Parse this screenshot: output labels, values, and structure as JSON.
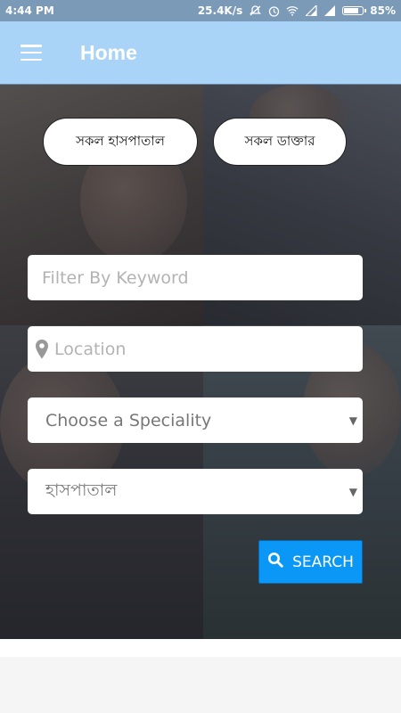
{
  "status_bar": {
    "time": "4:44 PM",
    "net_speed": "25.4K/s",
    "battery": "85%",
    "battery_level": 0.85,
    "icons": [
      "mute-icon",
      "alarm-icon",
      "wifi-icon",
      "signal-icon",
      "signal-icon",
      "battery-icon"
    ]
  },
  "app_bar": {
    "title": "Home",
    "menu_icon": "hamburger-menu-icon",
    "color": "#a9d4f7"
  },
  "categories": {
    "hospitals_label": "সকল হাসপাতাল",
    "doctors_label": "সকল ডাক্তার"
  },
  "form": {
    "keyword_placeholder": "Filter By Keyword",
    "location_placeholder": "Location",
    "speciality_selected": "Choose a Speciality",
    "hospital_selected": "হাসপাতাল",
    "search_label": "SEARCH",
    "search_icon": "search-icon",
    "location_icon": "map-pin-icon",
    "accent_color": "#0a97f5"
  }
}
